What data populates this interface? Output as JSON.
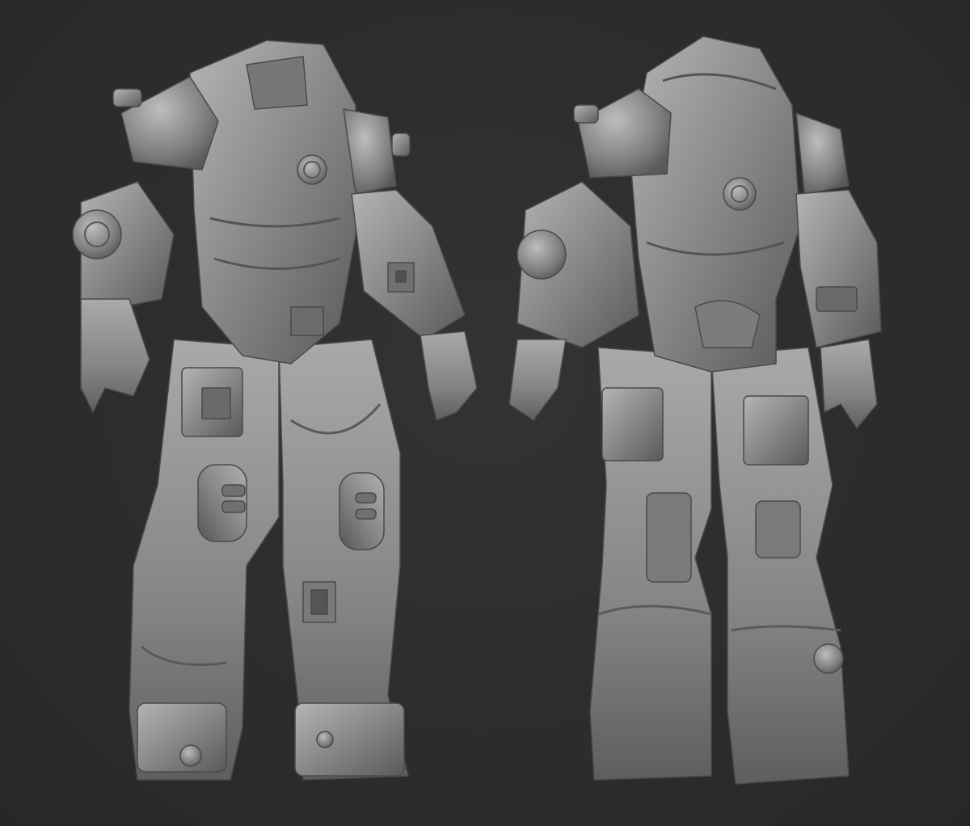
{
  "scene": {
    "background_color": "#2e2e2f",
    "material_color": "#8a8a8a",
    "views": [
      {
        "name": "front-view",
        "subject": "armored-suit-front"
      },
      {
        "name": "back-view",
        "subject": "armored-suit-back"
      }
    ]
  }
}
